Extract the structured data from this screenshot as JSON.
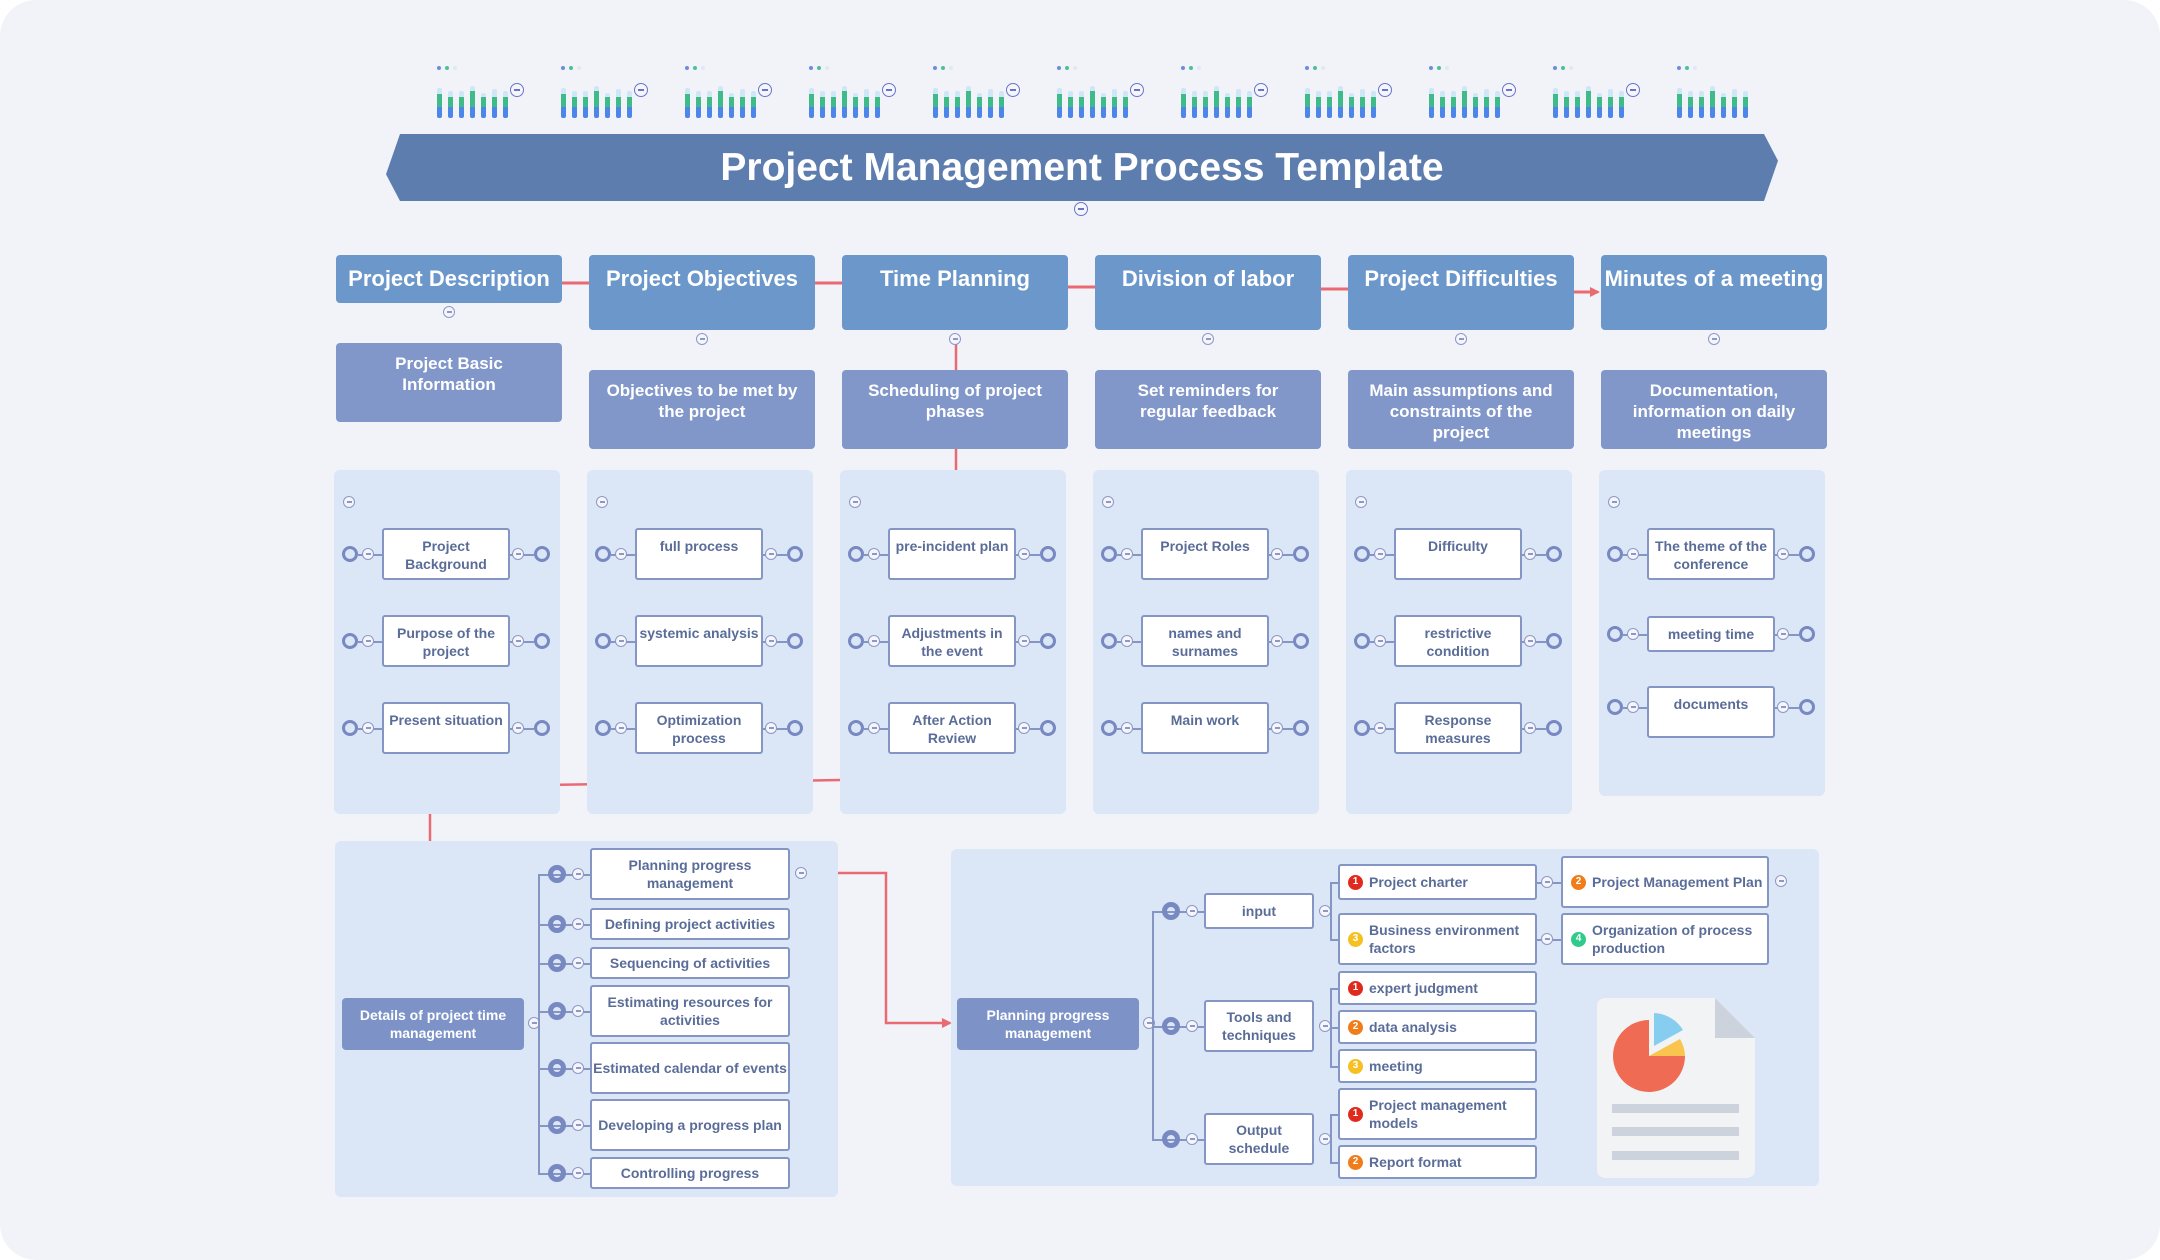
{
  "title": "Project Management Process Template",
  "colors": {
    "banner": "#5d7daf",
    "header_card": "#6b97cb",
    "sub_card": "#8197c9",
    "panel": "#dbe6f6",
    "connector_red": "#ea6a73",
    "node_border": "#8595c4",
    "badge_1": "#e02a1d",
    "badge_2": "#f07d1a",
    "badge_3": "#f5c022",
    "badge_4": "#2fcb8a"
  },
  "mini_charts": {
    "count": 11,
    "bar_levels": [
      {
        "total": 0.78,
        "green": 0.62,
        "blue": 0.3
      },
      {
        "total": 0.7,
        "green": 0.55,
        "blue": 0.3
      },
      {
        "total": 0.7,
        "green": 0.55,
        "blue": 0.3
      },
      {
        "total": 0.85,
        "green": 0.72,
        "blue": 0.3
      },
      {
        "total": 0.66,
        "green": 0.55,
        "blue": 0.3
      },
      {
        "total": 0.76,
        "green": 0.55,
        "blue": 0.3
      },
      {
        "total": 0.7,
        "green": 0.55,
        "blue": 0.3
      }
    ]
  },
  "columns": [
    {
      "header": "Project Description",
      "sub": "Project Basic Information",
      "nodes": [
        "Project Background",
        "Purpose of the project",
        "Present situation"
      ]
    },
    {
      "header": "Project Objectives",
      "sub": "Objectives to be met by the project",
      "nodes": [
        "full process",
        "systemic analysis",
        "Optimization process"
      ]
    },
    {
      "header": "Time Planning",
      "sub": "Scheduling of project phases",
      "nodes": [
        "pre-incident plan",
        "Adjustments in the event",
        "After Action Review"
      ]
    },
    {
      "header": "Division of labor",
      "sub": "Set reminders for regular feedback",
      "nodes": [
        "Project Roles",
        "names and surnames",
        "Main work"
      ]
    },
    {
      "header": "Project Difficulties",
      "sub": "Main assumptions and constraints of the project",
      "nodes": [
        "Difficulty",
        "restrictive condition",
        "Response measures"
      ]
    },
    {
      "header": "Minutes of a meeting",
      "sub": "Documentation, information on daily meetings",
      "nodes": [
        "The theme of the conference",
        "meeting time",
        "documents"
      ]
    }
  ],
  "time_management": {
    "root": "Details of project time management",
    "items": [
      "Planning progress management",
      "Defining project activities",
      "Sequencing of activities",
      "Estimating resources for activities",
      "Estimated calendar of events",
      "Developing a progress plan",
      "Controlling progress"
    ]
  },
  "planning": {
    "root": "Planning progress management",
    "groups": [
      {
        "label": "input",
        "items": [
          {
            "badge": "1",
            "text": "Project charter"
          },
          {
            "badge": "3",
            "text": "Business environment factors"
          }
        ]
      },
      {
        "label": "Tools and techniques",
        "items": [
          {
            "badge": "1",
            "text": "expert judgment"
          },
          {
            "badge": "2",
            "text": "data analysis"
          },
          {
            "badge": "3",
            "text": "meeting"
          }
        ]
      },
      {
        "label": "Output schedule",
        "items": [
          {
            "badge": "1",
            "text": "Project management models"
          },
          {
            "badge": "2",
            "text": "Report format"
          }
        ]
      }
    ],
    "extra": [
      {
        "badge": "2",
        "text": "Project Management Plan"
      },
      {
        "badge": "4",
        "text": "Organization of process production"
      }
    ]
  },
  "illustration": {
    "icon": "document-pie-chart-icon",
    "pie_slices": [
      {
        "label": "large",
        "color": "#ef6b54"
      },
      {
        "label": "small-yellow",
        "color": "#f9c54f"
      },
      {
        "label": "exploded-blue",
        "color": "#86cdf0"
      }
    ]
  }
}
